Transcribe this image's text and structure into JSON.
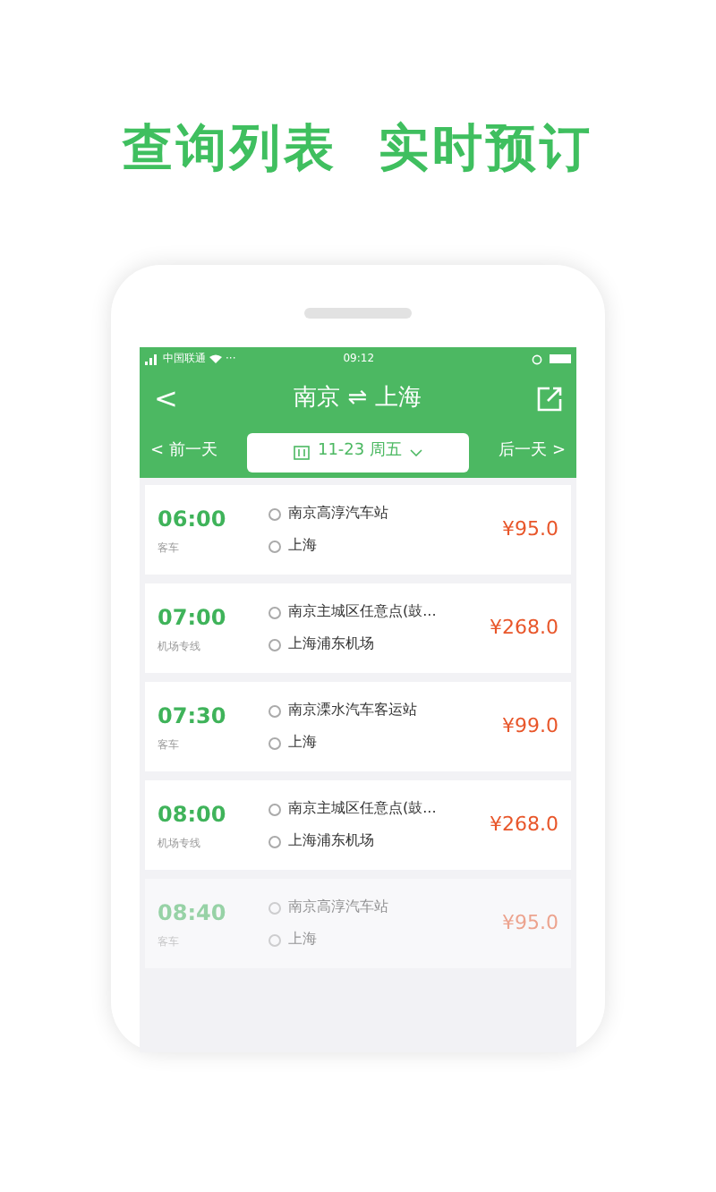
{
  "headline": "查询列表  实时预订",
  "status_bar": {
    "carrier": "中国联通",
    "dots": "···",
    "time": "09:12"
  },
  "nav": {
    "back": "<",
    "title": "南京 ⇌ 上海"
  },
  "date_bar": {
    "prev": "< 前一天",
    "date": "11-23 周五",
    "next": "后一天 >"
  },
  "trips": [
    {
      "time": "06:00",
      "type": "客车",
      "from": "南京高淳汽车站",
      "to": "上海",
      "price": "¥95.0",
      "faded": false
    },
    {
      "time": "07:00",
      "type": "机场专线",
      "from": "南京主城区任意点(鼓...",
      "to": "上海浦东机场",
      "price": "¥268.0",
      "faded": false
    },
    {
      "time": "07:30",
      "type": "客车",
      "from": "南京溧水汽车客运站",
      "to": "上海",
      "price": "¥99.0",
      "faded": false
    },
    {
      "time": "08:00",
      "type": "机场专线",
      "from": "南京主城区任意点(鼓...",
      "to": "上海浦东机场",
      "price": "¥268.0",
      "faded": false
    },
    {
      "time": "08:40",
      "type": "客车",
      "from": "南京高淳汽车站",
      "to": "上海",
      "price": "¥95.0",
      "faded": true
    }
  ]
}
